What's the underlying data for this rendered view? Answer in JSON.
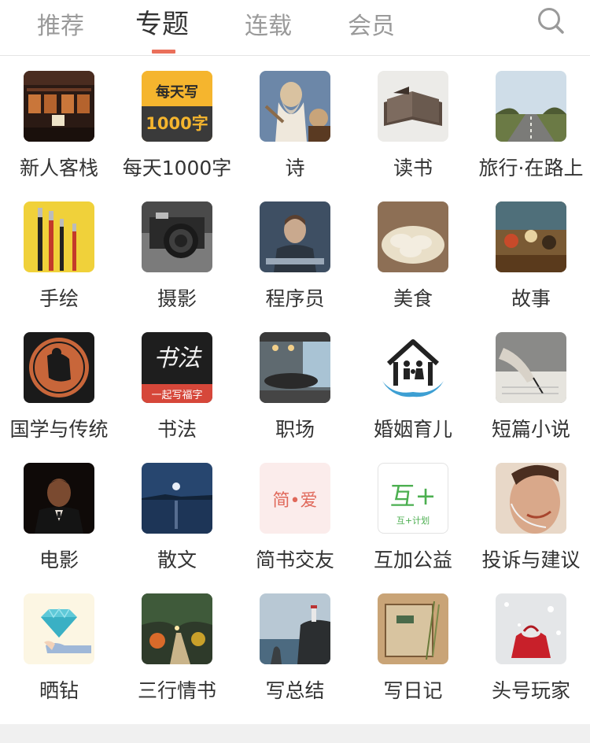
{
  "tabs": [
    {
      "label": "推荐",
      "active": false
    },
    {
      "label": "专题",
      "active": true
    },
    {
      "label": "连载",
      "active": false
    },
    {
      "label": "会员",
      "active": false
    }
  ],
  "accent_color": "#ea6f5a",
  "collections": [
    {
      "label": "新人客栈",
      "icon": "inn-night-icon"
    },
    {
      "label": "每天1000字",
      "icon": "daily-1000-words-icon",
      "icon_text_1": "每天写",
      "icon_text_2": "1000字"
    },
    {
      "label": "诗",
      "icon": "poet-statue-icon"
    },
    {
      "label": "读书",
      "icon": "open-book-icon"
    },
    {
      "label": "旅行·在路上",
      "icon": "road-trip-icon"
    },
    {
      "label": "手绘",
      "icon": "paint-brushes-icon"
    },
    {
      "label": "摄影",
      "icon": "camera-icon"
    },
    {
      "label": "程序员",
      "icon": "programmer-icon"
    },
    {
      "label": "美食",
      "icon": "dumplings-icon"
    },
    {
      "label": "故事",
      "icon": "story-painting-icon"
    },
    {
      "label": "国学与传统",
      "icon": "greek-pottery-icon"
    },
    {
      "label": "书法",
      "icon": "calligraphy-icon",
      "icon_text_1": "书法",
      "icon_text_2": "一起写福字"
    },
    {
      "label": "职场",
      "icon": "office-room-icon"
    },
    {
      "label": "婚姻育儿",
      "icon": "family-house-icon"
    },
    {
      "label": "短篇小说",
      "icon": "writing-hand-icon"
    },
    {
      "label": "电影",
      "icon": "godfather-portrait-icon"
    },
    {
      "label": "散文",
      "icon": "moon-lake-icon"
    },
    {
      "label": "简书交友",
      "icon": "jian-ai-icon",
      "icon_text_1": "简•爱"
    },
    {
      "label": "互加公益",
      "icon": "hujia-charity-icon",
      "icon_text_1": "互+",
      "icon_text_2": "互+计划"
    },
    {
      "label": "投诉与建议",
      "icon": "phone-headset-icon"
    },
    {
      "label": "晒钻",
      "icon": "diamond-icon"
    },
    {
      "label": "三行情书",
      "icon": "park-path-icon"
    },
    {
      "label": "写总结",
      "icon": "lighthouse-coast-icon"
    },
    {
      "label": "写日记",
      "icon": "diary-notebook-icon"
    },
    {
      "label": "头号玩家",
      "icon": "gift-bag-snow-icon"
    }
  ]
}
